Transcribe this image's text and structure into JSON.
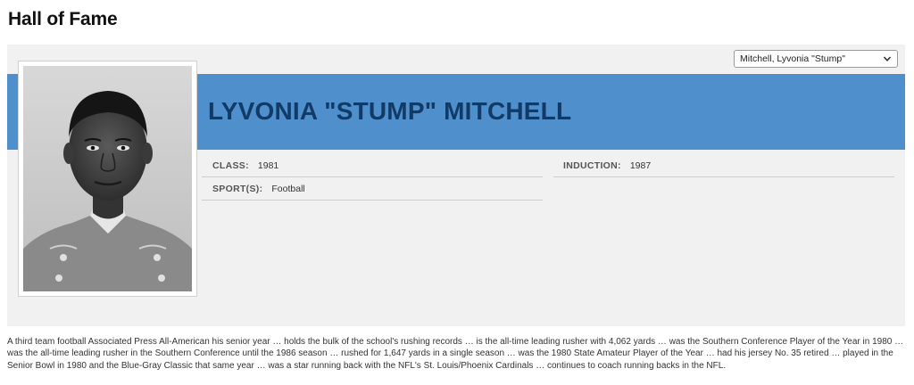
{
  "page": {
    "title": "Hall of Fame"
  },
  "selector": {
    "selected": "Mitchell, Lyvonia \"Stump\"",
    "icon": "chevron-down-icon"
  },
  "inductee": {
    "name": "LYVONIA \"STUMP\" MITCHELL",
    "photo_icon": "inductee-portrait",
    "fields": {
      "class_label": "CLASS:",
      "class_value": "1981",
      "induction_label": "INDUCTION:",
      "induction_value": "1987",
      "sport_label": "SPORT(S):",
      "sport_value": "Football"
    },
    "bio": "A third team football Associated Press All-American his senior year … holds the bulk of the school's rushing records … is the all-time leading rusher with 4,062 yards … was the Southern Conference Player of the Year in 1980 … was the all-time leading rusher in the Southern Conference until the 1986 season … rushed for 1,647 yards in a single season … was the 1980 State Amateur Player of the Year … had his jersey No. 35 retired … played in the Senior Bowl in 1980 and the Blue-Gray Classic that same year … was a star running back with the NFL's St. Louis/Phoenix Cardinals … continues to coach running backs in the NFL."
  },
  "colors": {
    "banner": "#4f8fcc",
    "name_text": "#123a66",
    "panel": "#f1f1f1"
  }
}
